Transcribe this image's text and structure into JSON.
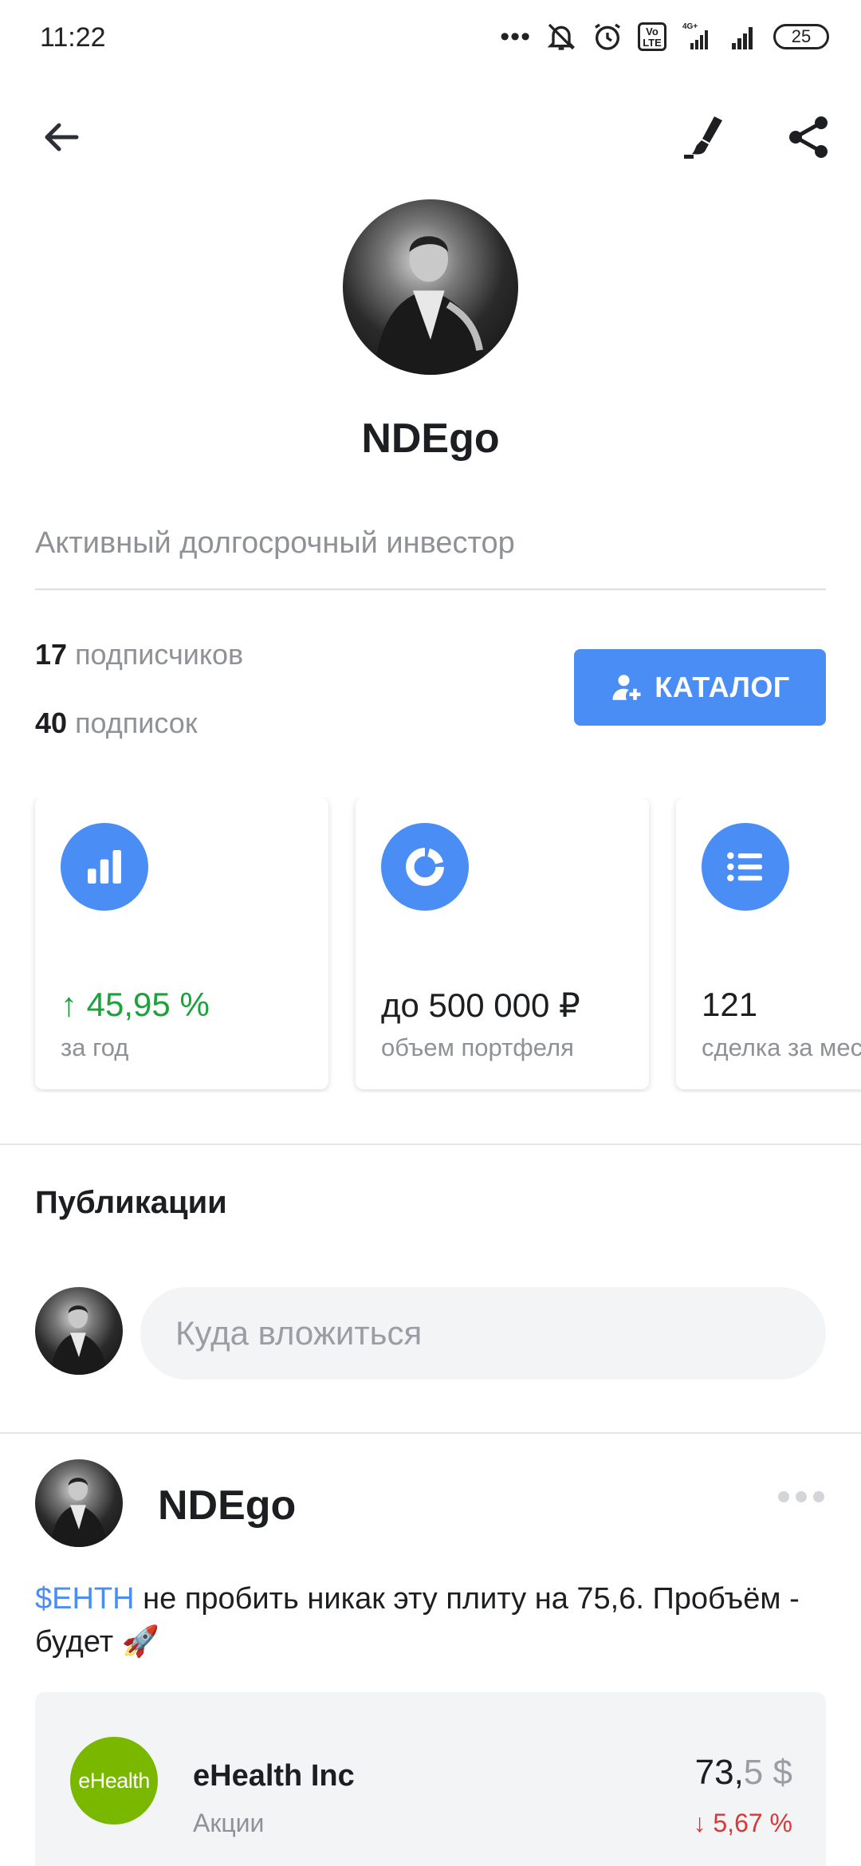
{
  "status_bar": {
    "time": "11:22",
    "network": "4G+",
    "volte": "Vo LTE",
    "battery": "25"
  },
  "profile": {
    "username": "NDEgo",
    "bio": "Активный долгосрочный инвестор",
    "followers_count": "17",
    "followers_label": "подписчиков",
    "following_count": "40",
    "following_label": "подписок",
    "catalog_button": "КАТАЛОГ"
  },
  "stat_cards": [
    {
      "icon": "bar-chart-icon",
      "value": "45,95 %",
      "label": "за год",
      "trend": "up"
    },
    {
      "icon": "donut-chart-icon",
      "value": "до 500 000 ₽",
      "label": "объем портфеля"
    },
    {
      "icon": "list-icon",
      "value": "121",
      "label": "сделка за месяц"
    }
  ],
  "publications": {
    "title": "Публикации",
    "compose_placeholder": "Куда вложиться"
  },
  "post": {
    "author": "NDEgo",
    "ticker": "$EHTH",
    "text": " не пробить никак эту плиту на 75,6. Пробъём - будет 🚀",
    "instrument": {
      "logo_text": "eHealth",
      "name": "eHealth Inc",
      "type": "Акции",
      "price_main": "73,",
      "price_decimal": "5",
      "currency": "$",
      "change": "5,67 %",
      "change_direction": "down"
    }
  },
  "colors": {
    "accent": "#4a8ef5",
    "positive": "#1aa33b",
    "negative": "#d93838",
    "muted_text": "#8e9196",
    "logo_green": "#7ab800"
  }
}
